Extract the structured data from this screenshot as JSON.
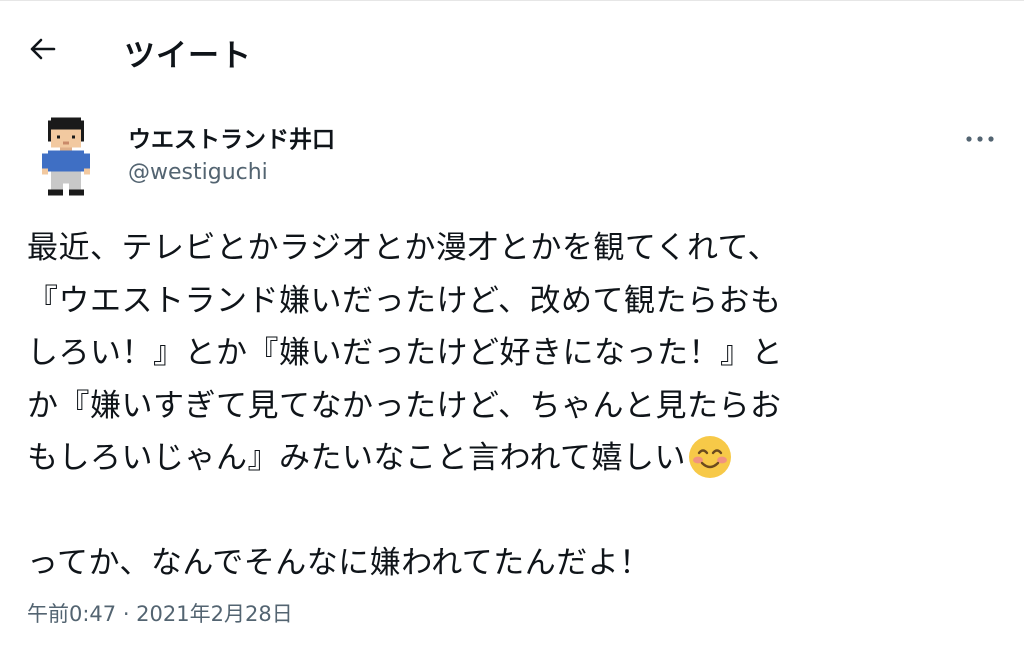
{
  "header": {
    "back_icon": "back-arrow-icon",
    "title": "ツイート"
  },
  "author": {
    "avatar_icon": "pixel-man-avatar",
    "display_name": "ウエストランド井口",
    "handle": "@westiguchi",
    "more_icon": "more-options-icon"
  },
  "tweet": {
    "lines": [
      "最近、テレビとかラジオとか漫才とかを観てくれて、",
      "『ウエストランド嫌いだったけど、改めて観たらおも",
      "しろい！』とか『嫌いだったけど好きになった！』と",
      "か『嫌いすぎて見てなかったけど、ちゃんと見たらお",
      "もしろいじゃん』みたいなこと言われて嬉しい",
      "ってか、なんでそんなに嫌われてたんだよ！"
    ],
    "emoji": "smiling-face-with-blush-emoji",
    "timestamp": "午前0:47 · 2021年2月28日"
  },
  "colors": {
    "text": "#0f1419",
    "secondary": "#536471",
    "emoji_face": "#f7c948",
    "avatar_shirt": "#3f6fc4"
  }
}
